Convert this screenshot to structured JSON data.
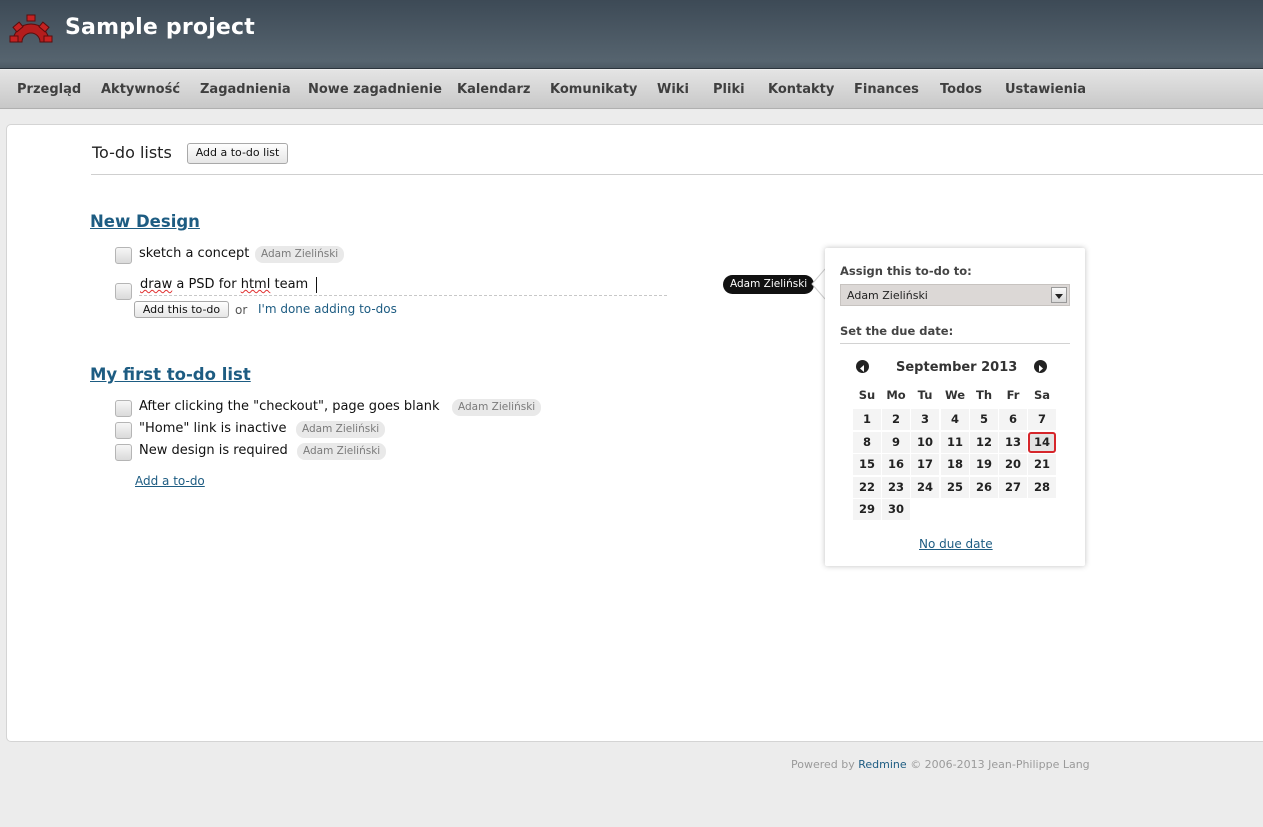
{
  "header": {
    "project_title": "Sample project"
  },
  "menu": [
    "Przegląd",
    "Aktywność",
    "Zagadnienia",
    "Nowe zagadnienie",
    "Kalendarz",
    "Komunikaty",
    "Wiki",
    "Pliki",
    "Kontakty",
    "Finances",
    "Todos",
    "Ustawienia"
  ],
  "page": {
    "title": "To-do lists",
    "add_list_button": "Add a to-do list"
  },
  "lists": [
    {
      "title": "New Design",
      "todos": [
        {
          "text": "sketch a concept",
          "assignee": "Adam Zieliński"
        }
      ],
      "new_todo": {
        "value_words": [
          "draw",
          "a",
          "PSD",
          "for",
          "html",
          "team"
        ],
        "add_button": "Add this to-do",
        "or": "or",
        "done_link": "I'm done adding to-dos"
      }
    },
    {
      "title": "My first to-do list",
      "todos": [
        {
          "text": "After clicking the \"checkout\", page goes blank",
          "assignee": "Adam Zieliński"
        },
        {
          "text": "\"Home\" link is inactive",
          "assignee": "Adam Zieliński"
        },
        {
          "text": "New design is required",
          "assignee": "Adam Zieliński"
        }
      ],
      "add_link": "Add a to-do"
    }
  ],
  "assignee_bubble": "Adam Zieliński",
  "popup": {
    "assign_label": "Assign this to-do to:",
    "assign_value": "Adam Zieliński",
    "due_label": "Set the due date:",
    "calendar": {
      "month": "September 2013",
      "weekdays": [
        "Su",
        "Mo",
        "Tu",
        "We",
        "Th",
        "Fr",
        "Sa"
      ],
      "weeks": [
        [
          "1",
          "2",
          "3",
          "4",
          "5",
          "6",
          "7"
        ],
        [
          "8",
          "9",
          "10",
          "11",
          "12",
          "13",
          "14"
        ],
        [
          "15",
          "16",
          "17",
          "18",
          "19",
          "20",
          "21"
        ],
        [
          "22",
          "23",
          "24",
          "25",
          "26",
          "27",
          "28"
        ],
        [
          "29",
          "30",
          "",
          "",
          "",
          "",
          ""
        ]
      ],
      "selected_day": "14",
      "selected_color": "#d6262b"
    },
    "no_due_date": "No due date"
  },
  "footer": {
    "prefix": "Powered by",
    "link": "Redmine",
    "suffix": "© 2006-2013 Jean-Philippe Lang"
  },
  "colors": {
    "link": "#1d5c82",
    "header": "#4a5863"
  }
}
